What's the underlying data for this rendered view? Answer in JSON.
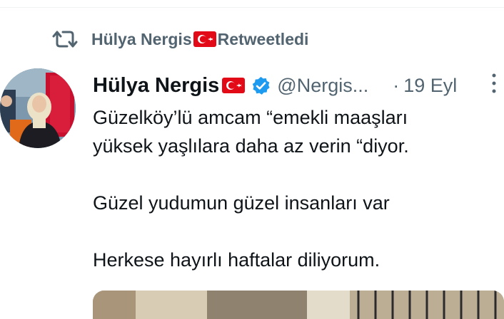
{
  "retweet": {
    "icon": "retweet-icon",
    "retweeter_name": "Hülya Nergis",
    "retweeter_flag": "turkish-flag-icon",
    "label": "Retweetledi"
  },
  "tweet": {
    "avatar": "profile-avatar",
    "author_name": "Hülya Nergis",
    "author_flag": "turkish-flag-icon",
    "verified": "verified-badge-icon",
    "handle": "@Nergis...",
    "separator": "·",
    "time": "19 Eyl",
    "more": "more-options-icon",
    "lines": [
      "Güzelköy’lü amcam “emekli maaşları",
      "yüksek yaşlılara daha az verin “diyor.",
      "Güzel yudumun güzel insanları var",
      "Herkese hayırlı haftalar diliyorum."
    ]
  },
  "colors": {
    "text_primary": "#0f1419",
    "text_secondary": "#536471",
    "verified_blue": "#1d9bf0",
    "flag_red": "#e30a17"
  }
}
